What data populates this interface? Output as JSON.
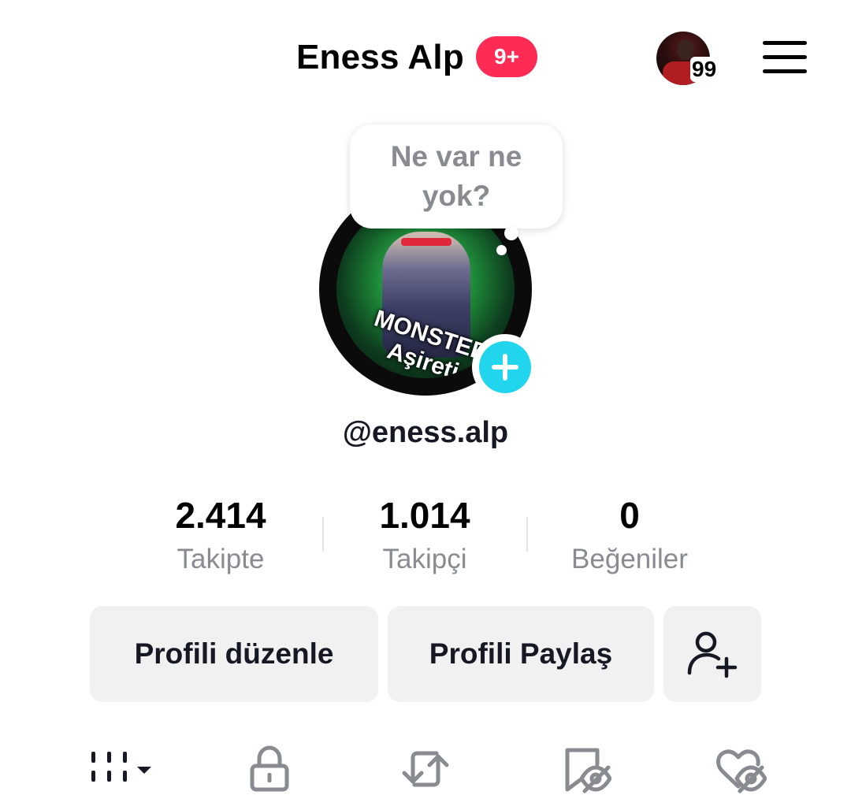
{
  "header": {
    "title": "Eness Alp",
    "notification_badge": "9+",
    "story_avatar_count": "99"
  },
  "profile": {
    "status_bubble": "Ne var ne yok?",
    "avatar_overlay_text": "MONSTER Aşireti",
    "username": "@eness.alp"
  },
  "stats": [
    {
      "value": "2.414",
      "label": "Takipte"
    },
    {
      "value": "1.014",
      "label": "Takipçi"
    },
    {
      "value": "0",
      "label": "Beğeniler"
    }
  ],
  "actions": {
    "edit_profile": "Profili düzenle",
    "share_profile": "Profili Paylaş"
  },
  "tabs": [
    {
      "icon": "videos-grid-icon"
    },
    {
      "icon": "lock-icon"
    },
    {
      "icon": "repost-icon"
    },
    {
      "icon": "favorites-hidden-icon"
    },
    {
      "icon": "liked-hidden-icon"
    }
  ],
  "colors": {
    "badge": "#fe2c55",
    "add_button": "#20d5ec",
    "muted_text": "#8a8b91",
    "button_bg": "#f1f1f2"
  }
}
